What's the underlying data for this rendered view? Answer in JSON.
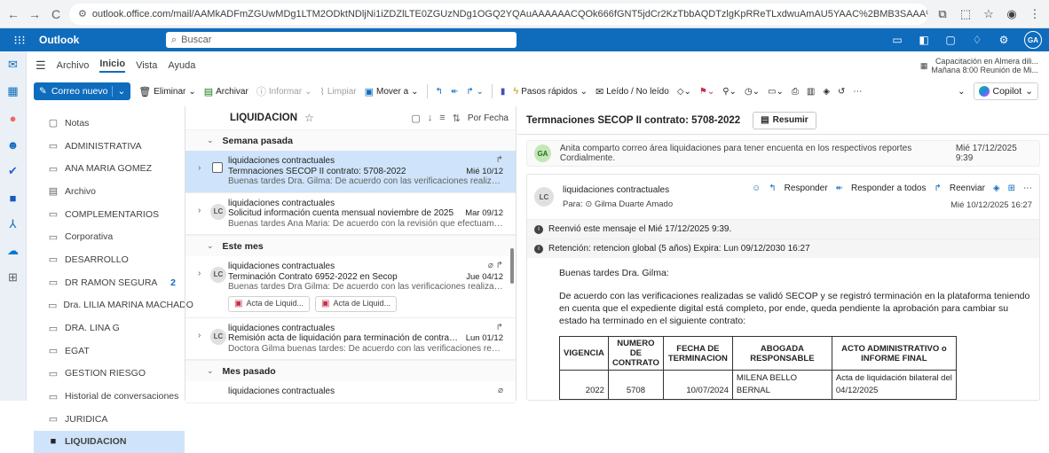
{
  "browser": {
    "url": "outlook.office.com/mail/AAMkADFmZGUwMDg1LTM2ODktNDljNi1iZDZlLTE0ZGUzNDg1OGQ2YQAuAAAAAACQOk666fGNT5jdCr2KzTbbAQDTzlgKpRReTLxdwuAmAU5YAAC%2BMB3SAAA%3D/id/AAQkADFmZGUwMDg1LTM2ODktNDljNi1iZDZlLTE0ZGU..."
  },
  "header": {
    "app_name": "Outlook",
    "search_placeholder": "Buscar",
    "avatar_initials": "GA"
  },
  "menu": {
    "tabs": [
      "Archivo",
      "Inicio",
      "Vista",
      "Ayuda"
    ],
    "active_tab": "Inicio"
  },
  "calendar_reminder": {
    "title": "Capacitación en Almera dili...",
    "subtitle": "Mañana 8:00 Reunión de Mi..."
  },
  "ribbon": {
    "new_mail": "Correo nuevo",
    "delete": "Eliminar",
    "archive": "Archivar",
    "report": "Informar",
    "sweep": "Limpiar",
    "move": "Mover a",
    "quick_steps": "Pasos rápidos",
    "read_unread": "Leído / No leído",
    "copilot": "Copilot"
  },
  "folders": [
    {
      "label": "Notas",
      "icon": "note-icon"
    },
    {
      "label": "ADMINISTRATIVA",
      "icon": "folder-icon"
    },
    {
      "label": "ANA MARIA GOMEZ",
      "icon": "folder-icon"
    },
    {
      "label": "Archivo",
      "icon": "archive-icon"
    },
    {
      "label": "COMPLEMENTARIOS",
      "icon": "folder-icon"
    },
    {
      "label": "Corporativa",
      "icon": "folder-icon"
    },
    {
      "label": "DESARROLLO",
      "icon": "folder-icon"
    },
    {
      "label": "DR RAMON SEGURA",
      "icon": "folder-icon",
      "count": "2"
    },
    {
      "label": "Dra. LILIA MARINA MACHADO",
      "icon": "folder-icon"
    },
    {
      "label": "DRA. LINA G",
      "icon": "folder-icon"
    },
    {
      "label": "EGAT",
      "icon": "folder-icon"
    },
    {
      "label": "GESTION RIESGO",
      "icon": "folder-icon"
    },
    {
      "label": "Historial de conversaciones",
      "icon": "folder-icon"
    },
    {
      "label": "JURIDICA",
      "icon": "folder-icon"
    },
    {
      "label": "LIQUIDACION",
      "icon": "folder-filled-icon",
      "selected": true
    }
  ],
  "list": {
    "title": "LIQUIDACION",
    "sort_label": "Por Fecha",
    "groups": [
      {
        "label": "Semana pasada"
      },
      {
        "label": "Este mes"
      },
      {
        "label": "Mes pasado"
      }
    ],
    "messages": [
      {
        "from": "liquidaciones contractuales",
        "subject": "Termnaciones SECOP II contrato: 5708-2022",
        "date": "Mié 10/12",
        "preview": "Buenas tardes Dra. Gilma: De acuerdo con las verificaciones realizadas se vali..."
      },
      {
        "from": "liquidaciones contractuales",
        "subject": "Solicitud información cuenta mensual noviembre de 2025",
        "date": "Mar 09/12",
        "preview": "Buenas tardes Ana Maria: De acuerdo con la revisión que efectuamos conjunt...",
        "avatar": "LC"
      },
      {
        "from": "liquidaciones contractuales",
        "subject": "Terminación Contrato 6952-2022 en Secop",
        "date": "Jue 04/12",
        "preview": "Buenas tardes Dra Gilma: De acuerdo con las verificaciones realizadas se valid...",
        "avatar": "LC",
        "attachments": [
          "Acta de Liquid...",
          "Acta de Liquid..."
        ]
      },
      {
        "from": "liquidaciones contractuales",
        "subject": "Remisión acta de liquidación para terminación de contratos en Se...",
        "date": "Lun 01/12",
        "preview": "Doctora Gilma buenas tardes: De acuerdo con las verificaciones realizadas se ...",
        "avatar": "LC"
      },
      {
        "from": "liquidaciones contractuales"
      }
    ]
  },
  "reading": {
    "subject": "Termnaciones SECOP II contrato: 5708-2022",
    "summarize": "Resumir",
    "collapsed": {
      "avatar": "GA",
      "text": "Anita comparto correo área liquidaciones para tener encuenta en los respectivos reportes Cordialmente.",
      "date": "Mié 17/12/2025 9:39"
    },
    "card": {
      "avatar": "LC",
      "from": "liquidaciones contractuales",
      "to": "Para: ⊙ Gilma Duarte Amado",
      "reply": "Responder",
      "reply_all": "Responder a todos",
      "forward": "Reenviar",
      "date": "Mié 10/12/2025 16:27",
      "info1": "Reenvió este mensaje el Mié 17/12/2025 9:39.",
      "info2": "Retención: retencion global (5 años) Expira: Lun 09/12/2030 16:27"
    },
    "body": {
      "greeting": "Buenas tardes Dra. Gilma:",
      "paragraph": "De acuerdo con las verificaciones realizadas se validó SECOP y se registró terminación en la plataforma teniendo en cuenta que el expediente digital está completo, por ende, queda pendiente la aprobación para cambiar su estado ha terminado en el siguiente contrato:",
      "table": {
        "headers": [
          "VIGENCIA",
          "NUMERO DE CONTRATO",
          "FECHA DE TERMINACION",
          "ABOGADA RESPONSABLE",
          "ACTO ADMINISTRATIVO o INFORME FINAL"
        ],
        "rows": [
          [
            "2022",
            "5708",
            "10/07/2024",
            "MILENA BELLO BERNAL",
            "Acta de liquidación bilateral del 04/12/2025"
          ]
        ]
      }
    }
  }
}
